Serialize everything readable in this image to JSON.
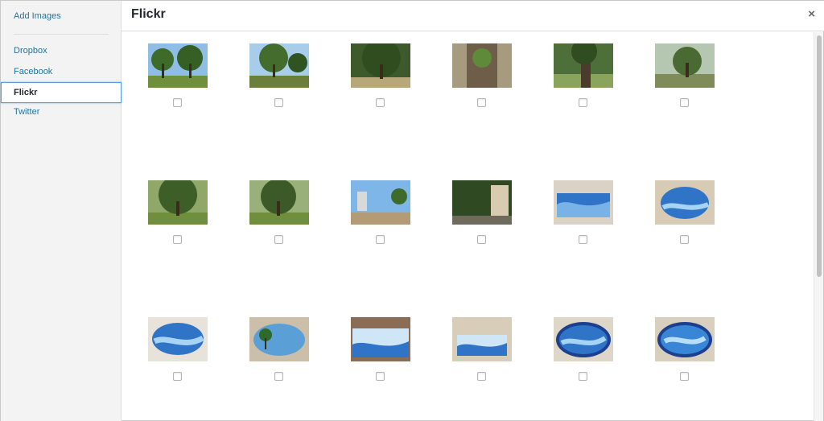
{
  "sidebar": {
    "add_images": "Add Images",
    "items": [
      {
        "label": "Dropbox"
      },
      {
        "label": "Facebook"
      },
      {
        "label": "Flickr"
      },
      {
        "label": "Twitter"
      }
    ]
  },
  "header": {
    "title": "Flickr",
    "close_symbol": "×"
  },
  "photos": [
    {
      "name": "photo-park-trees-1",
      "checked": false
    },
    {
      "name": "photo-park-trees-2",
      "checked": false
    },
    {
      "name": "photo-park-trees-3",
      "checked": false
    },
    {
      "name": "photo-tree-trunk-closeup",
      "checked": false
    },
    {
      "name": "photo-tree-trunk-park",
      "checked": false
    },
    {
      "name": "photo-olive-tree",
      "checked": false
    },
    {
      "name": "photo-large-tree-1",
      "checked": false
    },
    {
      "name": "photo-large-tree-2",
      "checked": false
    },
    {
      "name": "photo-palm-walkway",
      "checked": false
    },
    {
      "name": "photo-willow-path",
      "checked": false
    },
    {
      "name": "photo-painting-coast-1",
      "checked": false
    },
    {
      "name": "photo-painting-oval-coast-1",
      "checked": false
    },
    {
      "name": "photo-painting-oval-coast-2",
      "checked": false
    },
    {
      "name": "photo-painting-oval-tree",
      "checked": false
    },
    {
      "name": "photo-painting-sea-birds-1",
      "checked": false
    },
    {
      "name": "photo-painting-sea-birds-2",
      "checked": false
    },
    {
      "name": "photo-painting-oval-sea-1",
      "checked": false
    },
    {
      "name": "photo-painting-oval-sea-2",
      "checked": false
    }
  ]
}
